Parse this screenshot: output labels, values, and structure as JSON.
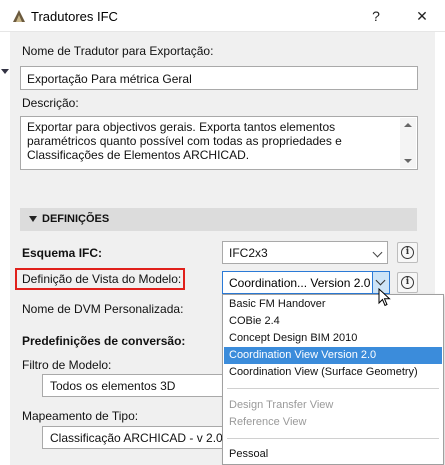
{
  "window": {
    "title": "Tradutores IFC",
    "help_label": "?",
    "close_label": "✕"
  },
  "translator": {
    "name_label": "Nome de Tradutor para Exportação:",
    "name_value": "Exportação Para métrica Geral",
    "description_label": "Descrição:",
    "description_value": "Exportar para objectivos gerais. Exporta tantos elementos paramétricos quanto possível com todas as propriedades e Classificações de Elementos ARCHICAD."
  },
  "settings": {
    "section_title": "DEFINIÇÕES",
    "ifc_schema_label": "Esquema IFC:",
    "ifc_schema_value": "IFC2x3",
    "mvd_label": "Definição de Vista do Modelo:",
    "mvd_value": "Coordination... Version 2.0",
    "custom_mvd_label": "Nome de DVM Personalizada:",
    "presets_label": "Predefinições de conversão:",
    "model_filter_label": "Filtro de Modelo:",
    "model_filter_value": "Todos os elementos 3D",
    "type_mapping_label": "Mapeamento de Tipo:",
    "type_mapping_value": "Classificação ARCHICAD - v 2.0 IFC"
  },
  "mvd_options": {
    "group1": [
      {
        "label": "Basic FM Handover",
        "state": "normal"
      },
      {
        "label": "COBie 2.4",
        "state": "normal"
      },
      {
        "label": "Concept Design BIM 2010",
        "state": "normal"
      },
      {
        "label": "Coordination View Version 2.0",
        "state": "selected"
      },
      {
        "label": "Coordination View (Surface Geometry)",
        "state": "normal"
      }
    ],
    "group2": [
      {
        "label": "Design Transfer View",
        "state": "disabled"
      },
      {
        "label": "Reference View",
        "state": "disabled"
      }
    ],
    "group3": [
      {
        "label": "Pessoal",
        "state": "normal"
      }
    ]
  },
  "colors": {
    "highlight_border": "#e0201b",
    "selection": "#3b8cdb",
    "dialog_bg": "#f0f0f0"
  },
  "icons": {
    "app": "archicad-logo-icon",
    "info": "info-icon",
    "dropdown": "chevron-down-icon",
    "section": "triangle-down-icon"
  }
}
